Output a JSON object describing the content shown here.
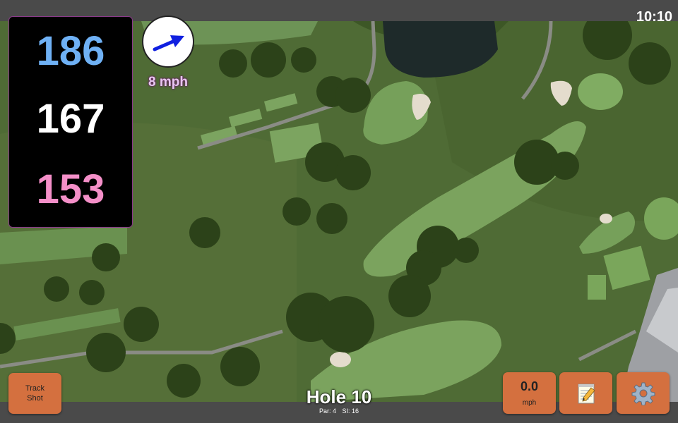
{
  "status": {
    "time": "10:10"
  },
  "distances": {
    "back": "186",
    "center": "167",
    "front": "153"
  },
  "wind": {
    "speed": "8 mph"
  },
  "hole": {
    "title": "Hole 10",
    "par": "Par: 4",
    "si": "SI: 16"
  },
  "buttons": {
    "track_shot": "Track\nShot",
    "speed_value": "0.0",
    "speed_unit": "mph"
  },
  "icons": {
    "wind": "wind-arrow-icon",
    "notes": "notepad-icon",
    "settings": "gear-icon"
  },
  "colors": {
    "back": "#6fb1f5",
    "center": "#ffffff",
    "front": "#f48fc8",
    "button": "#d4703f",
    "wind_arrow": "#1020e0"
  }
}
